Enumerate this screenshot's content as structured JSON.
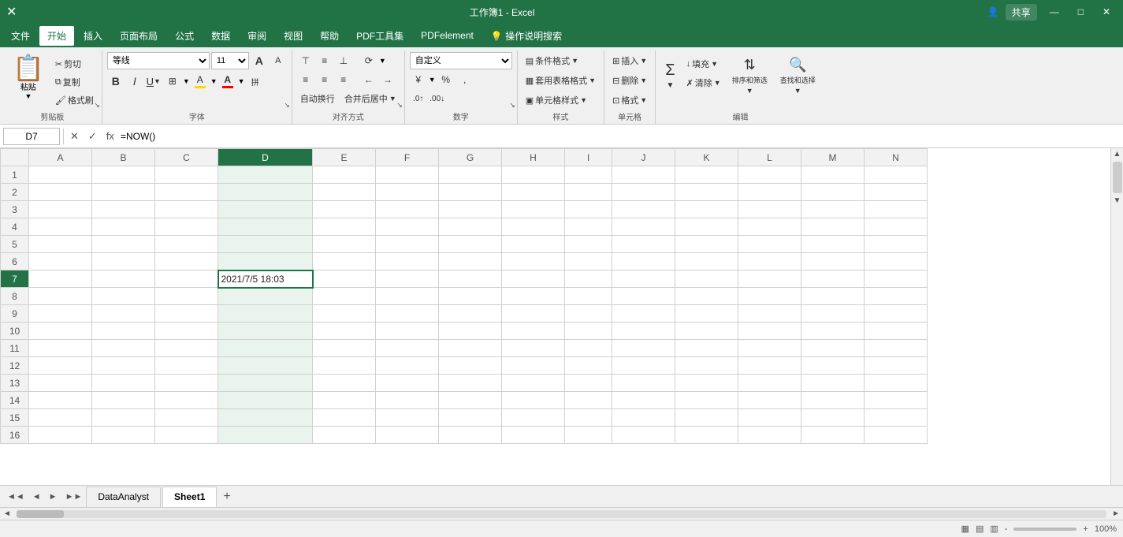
{
  "titlebar": {
    "filename": "工作簿1 - Excel",
    "share_btn": "共享",
    "user_icon": "👤"
  },
  "menubar": {
    "items": [
      "文件",
      "开始",
      "插入",
      "页面布局",
      "公式",
      "数据",
      "审阅",
      "视图",
      "帮助",
      "PDF工具集",
      "PDFelement",
      "💡操作说明搜索"
    ],
    "active": "开始"
  },
  "ribbon": {
    "groups": {
      "clipboard": {
        "label": "剪贴板",
        "paste_label": "粘贴",
        "cut_label": "剪切",
        "copy_label": "复制",
        "format_painter_label": "格式刷"
      },
      "font": {
        "label": "字体",
        "font_name": "等线",
        "font_size": "11",
        "bold": "B",
        "italic": "I",
        "underline": "U",
        "border_btn": "田",
        "fill_color": "A",
        "font_color": "A",
        "grow_font": "A↑",
        "shrink_font": "A↓"
      },
      "alignment": {
        "label": "对齐方式",
        "top_align": "⊤",
        "middle_align": "≡",
        "bottom_align": "⊥",
        "left_align": "≡",
        "center_align": "≡",
        "right_align": "≡",
        "decrease_indent": "←≡",
        "increase_indent": "→≡",
        "wrap_text": "自动换行",
        "merge_center": "合并后居中"
      },
      "number": {
        "label": "数字",
        "format": "自定义",
        "percent": "%",
        "comma": ",",
        "increase_decimal": ".0",
        "decrease_decimal": ".00",
        "currency": "¥"
      },
      "styles": {
        "label": "样式",
        "conditional_format": "条件格式",
        "table_style": "套用表格格式",
        "cell_style": "单元格样式"
      },
      "cells": {
        "label": "单元格",
        "insert": "插入",
        "delete": "删除",
        "format": "格式"
      },
      "editing": {
        "label": "编辑",
        "sum_label": "Σ",
        "fill_label": "填充",
        "clear_label": "清除",
        "sort_filter": "排序和筛选",
        "find_select": "查找和选择"
      }
    }
  },
  "formulabar": {
    "cell_ref": "D7",
    "cancel_btn": "✕",
    "confirm_btn": "✓",
    "formula_btn": "fx",
    "formula": "=NOW()"
  },
  "grid": {
    "cols": [
      "A",
      "B",
      "C",
      "D",
      "E",
      "F",
      "G",
      "H",
      "I",
      "J",
      "K",
      "L",
      "M",
      "N"
    ],
    "active_col": "D",
    "active_row": 7,
    "rows": 16,
    "cell_d7_value": "2021/7/5 18:03"
  },
  "sheets": {
    "tabs": [
      "DataAnalyst",
      "Sheet1"
    ],
    "active": "Sheet1",
    "add_btn": "+"
  },
  "statusbar": {
    "left": "",
    "right": ""
  }
}
